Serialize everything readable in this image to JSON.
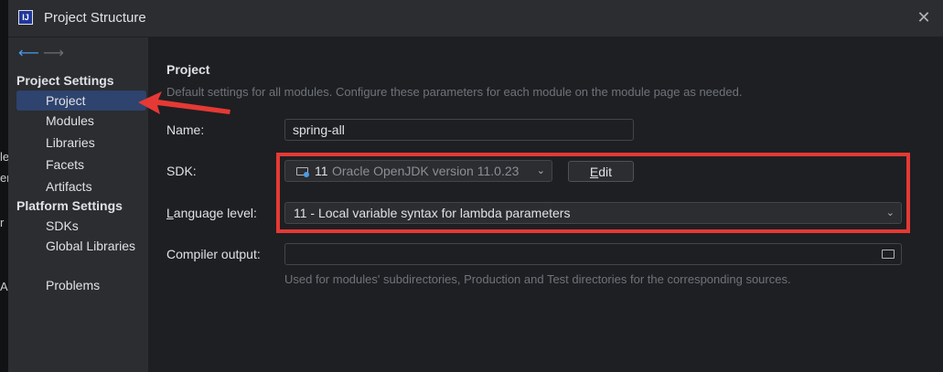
{
  "edge_fragments": [
    "le",
    "er",
    "r",
    "A"
  ],
  "window": {
    "title": "Project Structure"
  },
  "sidebar": {
    "project_settings_header": "Project Settings",
    "platform_settings_header": "Platform Settings",
    "items": [
      {
        "label": "Project",
        "selected": true
      },
      {
        "label": "Modules"
      },
      {
        "label": "Libraries"
      },
      {
        "label": "Facets"
      },
      {
        "label": "Artifacts"
      },
      {
        "label": "SDKs"
      },
      {
        "label": "Global Libraries"
      },
      {
        "label": "Problems"
      }
    ]
  },
  "project": {
    "title": "Project",
    "description": "Default settings for all modules. Configure these parameters for each module on the module page as needed.",
    "name_label": "Name:",
    "name_value": "spring-all",
    "sdk_label": "SDK:",
    "sdk_version": "11",
    "sdk_name": "Oracle OpenJDK version 11.0.23",
    "edit_button_first": "E",
    "edit_button_rest": "dit",
    "language_level_label_first": "L",
    "language_level_label_rest": "anguage level:",
    "language_level_value": "11 - Local variable syntax for lambda parameters",
    "compiler_output_label": "Compiler output:",
    "compiler_output_value": "",
    "compiler_output_hint": "Used for modules' subdirectories, Production and Test directories for the corresponding sources."
  },
  "colors": {
    "selection": "#2e436e",
    "annotation_red": "#e53935",
    "accent_blue": "#4b9be8"
  }
}
